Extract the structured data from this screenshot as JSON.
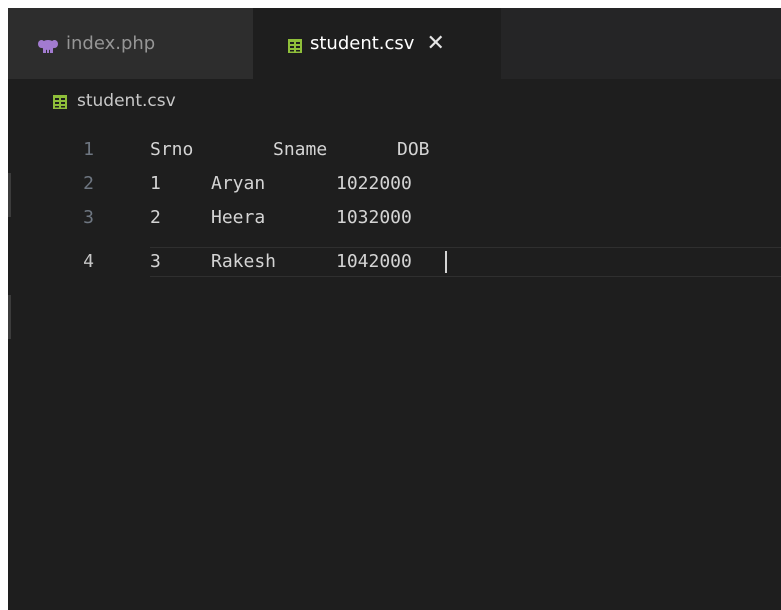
{
  "tabs": [
    {
      "label": "index.php",
      "icon": "php-elephant-icon",
      "active": false
    },
    {
      "label": "student.csv",
      "icon": "csv-table-icon",
      "active": true,
      "close": "✕"
    }
  ],
  "breadcrumb": {
    "label": "student.csv",
    "icon": "csv-table-icon"
  },
  "editor": {
    "lines": [
      {
        "number": "1",
        "cells": [
          "Srno",
          "Sname",
          "DOB"
        ]
      },
      {
        "number": "2",
        "cells": [
          "1",
          "Aryan",
          "1022000"
        ]
      },
      {
        "number": "3",
        "cells": [
          "2",
          "Heera",
          "1032000"
        ]
      },
      {
        "number": "4",
        "cells": [
          "3",
          "Rakesh",
          "1042000"
        ]
      }
    ],
    "current_line": "4"
  },
  "colors": {
    "editor_bg": "#1e1e1e",
    "tab_bar_bg": "#252526",
    "csv_icon": "#8fbf3a",
    "php_icon": "#a27bd0"
  }
}
